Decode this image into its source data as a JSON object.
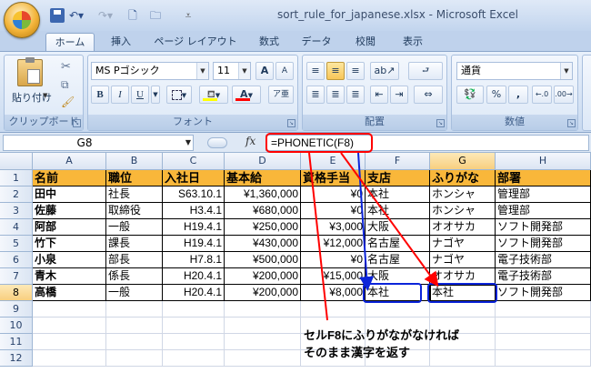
{
  "window": {
    "title": "sort_rule_for_japanese.xlsx - Microsoft Excel"
  },
  "tabs": [
    "ホーム",
    "挿入",
    "ページ レイアウト",
    "数式",
    "データ",
    "校閲",
    "表示"
  ],
  "ribbon": {
    "clipboard": {
      "label": "クリップボード",
      "paste": "貼り付け"
    },
    "font": {
      "label": "フォント",
      "name": "MS Pゴシック",
      "size": "11",
      "bold": "B",
      "italic": "I",
      "underline": "U",
      "grow": "A",
      "shrink": "A"
    },
    "alignment": {
      "label": "配置"
    },
    "number": {
      "label": "数値",
      "format": "通貨",
      "percent": "%",
      "comma": ","
    }
  },
  "formula_bar": {
    "name_box": "G8",
    "fx": "fx",
    "formula": "=PHONETIC(F8)"
  },
  "columns": [
    "A",
    "B",
    "C",
    "D",
    "E",
    "F",
    "G",
    "H"
  ],
  "rows": [
    "1",
    "2",
    "3",
    "4",
    "5",
    "6",
    "7",
    "8",
    "9",
    "10",
    "11",
    "12"
  ],
  "table": {
    "headers": [
      "名前",
      "職位",
      "入社日",
      "基本給",
      "資格手当",
      "支店",
      "ふりがな",
      "部署"
    ],
    "rows": [
      [
        "田中",
        "社長",
        "S63.10.1",
        "¥1,360,000",
        "¥0",
        "本社",
        "ホンシャ",
        "管理部"
      ],
      [
        "佐藤",
        "取締役",
        "H3.4.1",
        "¥680,000",
        "¥0",
        "本社",
        "ホンシャ",
        "管理部"
      ],
      [
        "阿部",
        "一般",
        "H19.4.1",
        "¥250,000",
        "¥3,000",
        "大阪",
        "オオサカ",
        "ソフト開発部"
      ],
      [
        "竹下",
        "課長",
        "H19.4.1",
        "¥430,000",
        "¥12,000",
        "名古屋",
        "ナゴヤ",
        "ソフト開発部"
      ],
      [
        "小泉",
        "部長",
        "H7.8.1",
        "¥500,000",
        "¥0",
        "名古屋",
        "ナゴヤ",
        "電子技術部"
      ],
      [
        "青木",
        "係長",
        "H20.4.1",
        "¥200,000",
        "¥15,000",
        "大阪",
        "オオサカ",
        "電子技術部"
      ],
      [
        "高橋",
        "一般",
        "H20.4.1",
        "¥200,000",
        "¥8,000",
        "本社",
        "本社",
        "ソフト開発部"
      ]
    ]
  },
  "annotation": {
    "line1": "セルF8にふりがながなければ",
    "line2": "そのまま漢字を返す"
  },
  "colors": {
    "header_fill": "#f9b73a",
    "annotation_red": "#ff0000",
    "highlight_blue": "#0b24d9"
  }
}
